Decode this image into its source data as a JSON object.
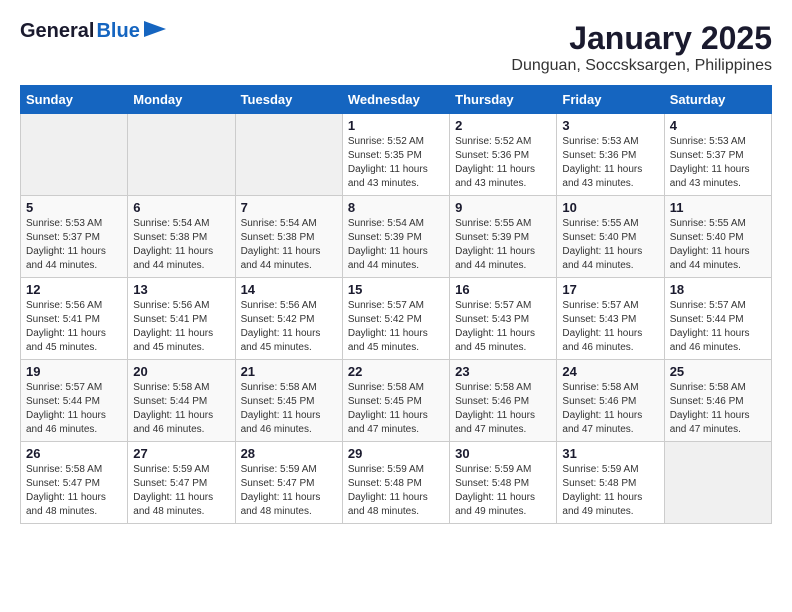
{
  "header": {
    "logo_general": "General",
    "logo_blue": "Blue",
    "main_title": "January 2025",
    "subtitle": "Dunguan, Soccsksargen, Philippines"
  },
  "weekdays": [
    "Sunday",
    "Monday",
    "Tuesday",
    "Wednesday",
    "Thursday",
    "Friday",
    "Saturday"
  ],
  "weeks": [
    [
      {
        "day": "",
        "info": ""
      },
      {
        "day": "",
        "info": ""
      },
      {
        "day": "",
        "info": ""
      },
      {
        "day": "1",
        "info": "Sunrise: 5:52 AM\nSunset: 5:35 PM\nDaylight: 11 hours\nand 43 minutes."
      },
      {
        "day": "2",
        "info": "Sunrise: 5:52 AM\nSunset: 5:36 PM\nDaylight: 11 hours\nand 43 minutes."
      },
      {
        "day": "3",
        "info": "Sunrise: 5:53 AM\nSunset: 5:36 PM\nDaylight: 11 hours\nand 43 minutes."
      },
      {
        "day": "4",
        "info": "Sunrise: 5:53 AM\nSunset: 5:37 PM\nDaylight: 11 hours\nand 43 minutes."
      }
    ],
    [
      {
        "day": "5",
        "info": "Sunrise: 5:53 AM\nSunset: 5:37 PM\nDaylight: 11 hours\nand 44 minutes."
      },
      {
        "day": "6",
        "info": "Sunrise: 5:54 AM\nSunset: 5:38 PM\nDaylight: 11 hours\nand 44 minutes."
      },
      {
        "day": "7",
        "info": "Sunrise: 5:54 AM\nSunset: 5:38 PM\nDaylight: 11 hours\nand 44 minutes."
      },
      {
        "day": "8",
        "info": "Sunrise: 5:54 AM\nSunset: 5:39 PM\nDaylight: 11 hours\nand 44 minutes."
      },
      {
        "day": "9",
        "info": "Sunrise: 5:55 AM\nSunset: 5:39 PM\nDaylight: 11 hours\nand 44 minutes."
      },
      {
        "day": "10",
        "info": "Sunrise: 5:55 AM\nSunset: 5:40 PM\nDaylight: 11 hours\nand 44 minutes."
      },
      {
        "day": "11",
        "info": "Sunrise: 5:55 AM\nSunset: 5:40 PM\nDaylight: 11 hours\nand 44 minutes."
      }
    ],
    [
      {
        "day": "12",
        "info": "Sunrise: 5:56 AM\nSunset: 5:41 PM\nDaylight: 11 hours\nand 45 minutes."
      },
      {
        "day": "13",
        "info": "Sunrise: 5:56 AM\nSunset: 5:41 PM\nDaylight: 11 hours\nand 45 minutes."
      },
      {
        "day": "14",
        "info": "Sunrise: 5:56 AM\nSunset: 5:42 PM\nDaylight: 11 hours\nand 45 minutes."
      },
      {
        "day": "15",
        "info": "Sunrise: 5:57 AM\nSunset: 5:42 PM\nDaylight: 11 hours\nand 45 minutes."
      },
      {
        "day": "16",
        "info": "Sunrise: 5:57 AM\nSunset: 5:43 PM\nDaylight: 11 hours\nand 45 minutes."
      },
      {
        "day": "17",
        "info": "Sunrise: 5:57 AM\nSunset: 5:43 PM\nDaylight: 11 hours\nand 46 minutes."
      },
      {
        "day": "18",
        "info": "Sunrise: 5:57 AM\nSunset: 5:44 PM\nDaylight: 11 hours\nand 46 minutes."
      }
    ],
    [
      {
        "day": "19",
        "info": "Sunrise: 5:57 AM\nSunset: 5:44 PM\nDaylight: 11 hours\nand 46 minutes."
      },
      {
        "day": "20",
        "info": "Sunrise: 5:58 AM\nSunset: 5:44 PM\nDaylight: 11 hours\nand 46 minutes."
      },
      {
        "day": "21",
        "info": "Sunrise: 5:58 AM\nSunset: 5:45 PM\nDaylight: 11 hours\nand 46 minutes."
      },
      {
        "day": "22",
        "info": "Sunrise: 5:58 AM\nSunset: 5:45 PM\nDaylight: 11 hours\nand 47 minutes."
      },
      {
        "day": "23",
        "info": "Sunrise: 5:58 AM\nSunset: 5:46 PM\nDaylight: 11 hours\nand 47 minutes."
      },
      {
        "day": "24",
        "info": "Sunrise: 5:58 AM\nSunset: 5:46 PM\nDaylight: 11 hours\nand 47 minutes."
      },
      {
        "day": "25",
        "info": "Sunrise: 5:58 AM\nSunset: 5:46 PM\nDaylight: 11 hours\nand 47 minutes."
      }
    ],
    [
      {
        "day": "26",
        "info": "Sunrise: 5:58 AM\nSunset: 5:47 PM\nDaylight: 11 hours\nand 48 minutes."
      },
      {
        "day": "27",
        "info": "Sunrise: 5:59 AM\nSunset: 5:47 PM\nDaylight: 11 hours\nand 48 minutes."
      },
      {
        "day": "28",
        "info": "Sunrise: 5:59 AM\nSunset: 5:47 PM\nDaylight: 11 hours\nand 48 minutes."
      },
      {
        "day": "29",
        "info": "Sunrise: 5:59 AM\nSunset: 5:48 PM\nDaylight: 11 hours\nand 48 minutes."
      },
      {
        "day": "30",
        "info": "Sunrise: 5:59 AM\nSunset: 5:48 PM\nDaylight: 11 hours\nand 49 minutes."
      },
      {
        "day": "31",
        "info": "Sunrise: 5:59 AM\nSunset: 5:48 PM\nDaylight: 11 hours\nand 49 minutes."
      },
      {
        "day": "",
        "info": ""
      }
    ]
  ]
}
